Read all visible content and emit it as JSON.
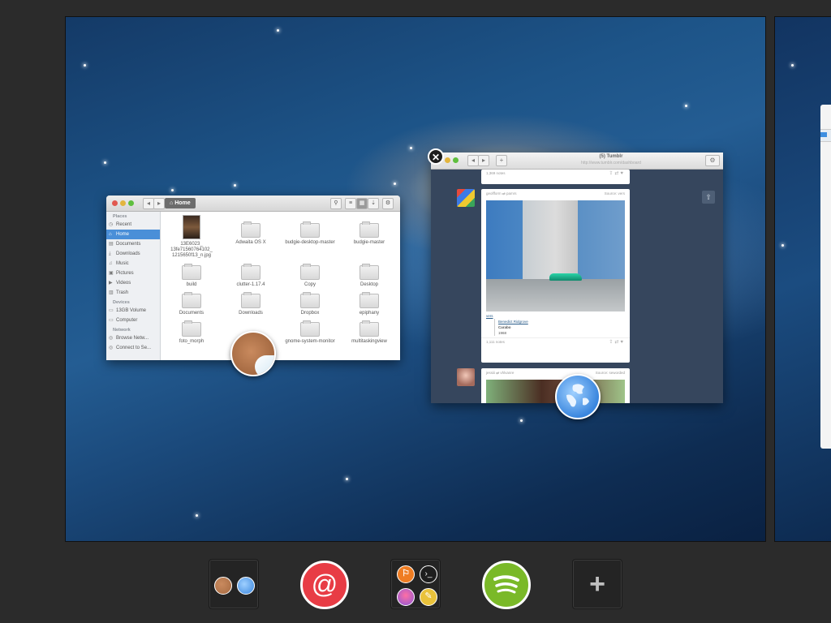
{
  "files_window": {
    "breadcrumb": "Home",
    "sidebar": {
      "places_heading": "Places",
      "places": [
        {
          "label": "Recent",
          "icon": "clock-icon"
        },
        {
          "label": "Home",
          "icon": "home-icon",
          "selected": true
        },
        {
          "label": "Documents",
          "icon": "document-icon"
        },
        {
          "label": "Downloads",
          "icon": "download-icon"
        },
        {
          "label": "Music",
          "icon": "music-icon"
        },
        {
          "label": "Pictures",
          "icon": "picture-icon"
        },
        {
          "label": "Videos",
          "icon": "video-icon"
        },
        {
          "label": "Trash",
          "icon": "trash-icon"
        }
      ],
      "devices_heading": "Devices",
      "devices": [
        {
          "label": "13GB Volume",
          "icon": "drive-icon"
        },
        {
          "label": "Computer",
          "icon": "computer-icon"
        }
      ],
      "network_heading": "Network",
      "network": [
        {
          "label": "Browse Netw...",
          "icon": "network-icon"
        },
        {
          "label": "Connect to Se...",
          "icon": "server-icon"
        }
      ]
    },
    "files": [
      {
        "label": "13E6023_ 13fe71560764102_ 1215650f13_n.jpg",
        "kind": "image"
      },
      {
        "label": "Adwaita OS X",
        "kind": "folder"
      },
      {
        "label": "budgie-desktop-master",
        "kind": "folder"
      },
      {
        "label": "budgie-master",
        "kind": "folder"
      },
      {
        "label": "build",
        "kind": "folder"
      },
      {
        "label": "clutter-1.17.4",
        "kind": "folder"
      },
      {
        "label": "Copy",
        "kind": "folder"
      },
      {
        "label": "Desktop",
        "kind": "folder"
      },
      {
        "label": "Documents",
        "kind": "folder"
      },
      {
        "label": "Downloads",
        "kind": "folder"
      },
      {
        "label": "Dropbox",
        "kind": "folder"
      },
      {
        "label": "epiphany",
        "kind": "folder"
      },
      {
        "label": "foto_morph",
        "kind": "folder"
      },
      {
        "label": "",
        "kind": "folder"
      },
      {
        "label": "gnome-system-monitor",
        "kind": "folder"
      },
      {
        "label": "multitaskingview",
        "kind": "folder"
      }
    ]
  },
  "browser_window": {
    "title": "(5) Tumblr",
    "url": "http://www.tumblr.com/dashboard",
    "posts": [
      {
        "top_notes": "1,369 notes"
      },
      {
        "author": "geolfform",
        "reblog_from": "pamrs",
        "source": "Source: vers",
        "link": "vers",
        "caption_link": "Benedict Ridgrove",
        "caption_title": "Carabo",
        "caption_year": "1968",
        "notes": "1,111 notes"
      },
      {
        "author": "jessiii",
        "reblog_from": "vhlvanre",
        "source": "Source: seworded"
      }
    ]
  },
  "close_label": "✕",
  "dock": {
    "items": [
      {
        "name": "dock-workspace-group",
        "icons": [
          "sticker-icon",
          "globe-icon"
        ]
      },
      {
        "name": "dock-mail",
        "symbol": "@",
        "color": "#e83c45"
      },
      {
        "name": "dock-app-group",
        "icons": [
          "flag-icon",
          "terminal-icon",
          "owl-icon",
          "pencil-icon"
        ]
      },
      {
        "name": "dock-spotify",
        "color": "#7ab928"
      },
      {
        "name": "dock-add-workspace",
        "symbol": "+"
      }
    ]
  }
}
